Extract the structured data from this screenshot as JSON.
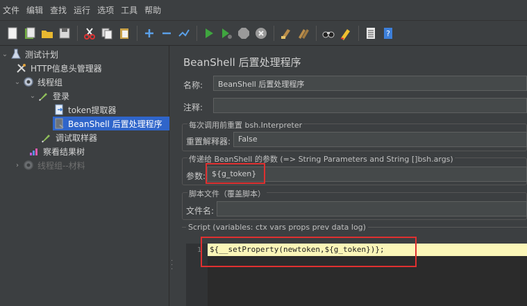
{
  "menu": [
    "文件",
    "编辑",
    "查找",
    "运行",
    "选项",
    "工具",
    "帮助"
  ],
  "toolbar_icons": [
    "new-icon",
    "templates-icon",
    "open-icon",
    "save-icon",
    "cut-icon",
    "copy-icon",
    "paste-icon",
    "add-icon",
    "remove-icon",
    "toggle-icon",
    "start-icon",
    "start-no-pause-icon",
    "stop-icon",
    "shutdown-icon",
    "clear-icon",
    "clear-all-icon",
    "search-icon",
    "reset-search-icon",
    "function-helper-icon",
    "help-icon"
  ],
  "tree": {
    "root": "测试计划",
    "http_header": "HTTP信息头管理器",
    "thread_group": "线程组",
    "login": "登录",
    "token_extractor": "token提取器",
    "beanshell_post": "BeanShell 后置处理程序",
    "debug_sampler": "调试取样器",
    "result_tree": "察看结果树",
    "thread_group_2": "线程组--材料"
  },
  "panel": {
    "title": "BeanShell 后置处理程序",
    "name_label": "名称:",
    "name_value": "BeanShell 后置处理程序",
    "comment_label": "注释:",
    "comment_value": "",
    "reset_section": "每次调用前重置 bsh.Interpreter",
    "reset_label": "重置解释器:",
    "reset_value": "False",
    "params_section": "传递给 BeanShell 的参数 (=> String Parameters and String []bsh.args)",
    "params_label": "参数:",
    "params_value": "${g_token}",
    "script_file_section": "脚本文件（覆盖脚本）",
    "filename_label": "文件名:",
    "filename_value": "",
    "script_section": "Script (variables: ctx vars props prev data log)",
    "line_number": "1",
    "code": "${__setProperty(newtoken,${g_token})};"
  },
  "colors": {
    "background": "#3c3f41",
    "selection": "#2f65ca",
    "highlight_box": "#e03030",
    "code_line": "#fbf6b8"
  }
}
